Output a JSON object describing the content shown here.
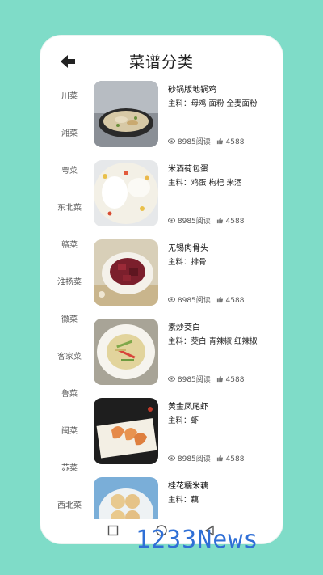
{
  "header": {
    "title": "菜谱分类"
  },
  "sidebar": {
    "items": [
      "川菜",
      "湘菜",
      "粤菜",
      "东北菜",
      "赣菜",
      "淮扬菜",
      "徽菜",
      "客家菜",
      "鲁菜",
      "闽菜",
      "苏菜",
      "西北菜"
    ]
  },
  "recipes": [
    {
      "name": "砂锅版地锅鸡",
      "ingredients": "主料：母鸡 面粉 全麦面粉",
      "views": "8985阅读",
      "likes": "4588"
    },
    {
      "name": "米酒荷包蛋",
      "ingredients": "主料：鸡蛋 枸杞 米酒",
      "views": "8985阅读",
      "likes": "4588"
    },
    {
      "name": "无锡肉骨头",
      "ingredients": "主料：排骨",
      "views": "8985阅读",
      "likes": "4588"
    },
    {
      "name": "素炒茭白",
      "ingredients": "主料：茭白 青辣椒 红辣椒",
      "views": "8985阅读",
      "likes": "4588"
    },
    {
      "name": "黄金凤尾虾",
      "ingredients": "主料：虾",
      "views": "8985阅读",
      "likes": "4588"
    },
    {
      "name": "桂花糯米藕",
      "ingredients": "主料：藕",
      "views": "",
      "likes": ""
    }
  ],
  "watermark": "1233News"
}
